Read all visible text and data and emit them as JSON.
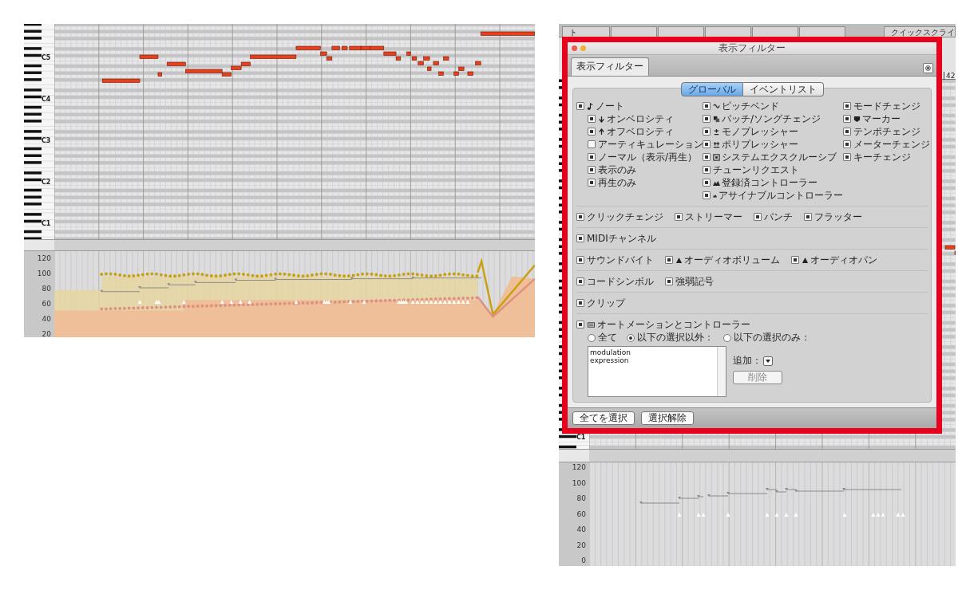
{
  "left_editor": {
    "octave_labels": [
      "C5",
      "C4",
      "C3",
      "C2",
      "C1"
    ],
    "velocity_axis": [
      "120",
      "100",
      "80",
      "60",
      "40",
      "20"
    ]
  },
  "right_editor": {
    "tabs": [
      {
        "label": "ト",
        "selected": false
      },
      {
        "label": "クイックスクライ",
        "selected": false
      }
    ],
    "ruler_mark": "42",
    "octave_labels": [
      "C1"
    ],
    "velocity_axis": [
      "120",
      "100",
      "80",
      "60",
      "40",
      "20",
      "0"
    ]
  },
  "dialog": {
    "title": "表示フィルター",
    "tab": {
      "label": "表示フィルター",
      "selected": true
    },
    "segments": [
      {
        "label": "グローバル",
        "selected": true
      },
      {
        "label": "イベントリスト",
        "selected": false
      }
    ],
    "columns": [
      {
        "items": [
          {
            "label": "ノート",
            "checked": true,
            "kind": "note",
            "children": [
              {
                "label": "オンベロシティ",
                "checked": true,
                "kind": "down"
              },
              {
                "label": "オフベロシティ",
                "checked": true,
                "kind": "up"
              },
              {
                "label": "アーティキュレーション",
                "checked": false
              },
              {
                "label": "ノーマル（表示/再生）",
                "checked": true
              },
              {
                "label": "表示のみ",
                "checked": true
              },
              {
                "label": "再生のみ",
                "checked": true
              }
            ]
          }
        ]
      },
      {
        "items": [
          {
            "label": "ピッチベンド",
            "checked": true,
            "kind": "pitch"
          },
          {
            "label": "パッチ/ソングチェンジ",
            "checked": true,
            "kind": "patch"
          },
          {
            "label": "モノプレッシャー",
            "checked": true,
            "kind": "mono"
          },
          {
            "label": "ポリプレッシャー",
            "checked": true,
            "kind": "poly"
          },
          {
            "label": "システムエクスクルーシブ",
            "checked": true,
            "kind": "sysex"
          },
          {
            "label": "チューンリクエスト",
            "checked": true
          },
          {
            "label": "登録済コントローラー",
            "checked": true,
            "kind": "controller"
          },
          {
            "label": "アサイナブルコントローラー",
            "checked": true,
            "kind": "controller"
          }
        ]
      },
      {
        "items": [
          {
            "label": "モードチェンジ",
            "checked": true
          },
          {
            "label": "マーカー",
            "checked": true,
            "kind": "marker"
          },
          {
            "label": "テンポチェンジ",
            "checked": true
          },
          {
            "label": "メーターチェンジ",
            "checked": true
          },
          {
            "label": "キーチェンジ",
            "checked": true
          }
        ]
      }
    ],
    "sections": [
      {
        "items": [
          {
            "label": "クリックチェンジ",
            "checked": true
          },
          {
            "label": "ストリーマー",
            "checked": true
          },
          {
            "label": "パンチ",
            "checked": true
          },
          {
            "label": "フラッター",
            "checked": true
          }
        ]
      },
      {
        "items": [
          {
            "label": "MIDIチャンネル",
            "checked": true
          }
        ]
      },
      {
        "items": [
          {
            "label": "サウンドバイト",
            "checked": true
          },
          {
            "label": "オーディオボリューム",
            "checked": true,
            "kind": "audio"
          },
          {
            "label": "オーディオパン",
            "checked": true,
            "kind": "audio"
          }
        ]
      },
      {
        "items": [
          {
            "label": "コードシンボル",
            "checked": true
          },
          {
            "label": "強弱記号",
            "checked": true
          }
        ]
      },
      {
        "items": [
          {
            "label": "クリップ",
            "checked": true
          }
        ]
      }
    ],
    "automation": {
      "label": "オートメーションとコントローラー",
      "checked": true,
      "kind": "automation",
      "modes": [
        {
          "label": "全て",
          "selected": false
        },
        {
          "label": "以下の選択以外：",
          "selected": true
        },
        {
          "label": "以下の選択のみ：",
          "selected": false
        }
      ],
      "list": [
        "modulation",
        "expression"
      ],
      "add_label": "追加：",
      "remove_button": {
        "label": "削除",
        "disabled": true
      }
    },
    "footer_buttons": [
      "全てを選択",
      "選択解除"
    ]
  }
}
